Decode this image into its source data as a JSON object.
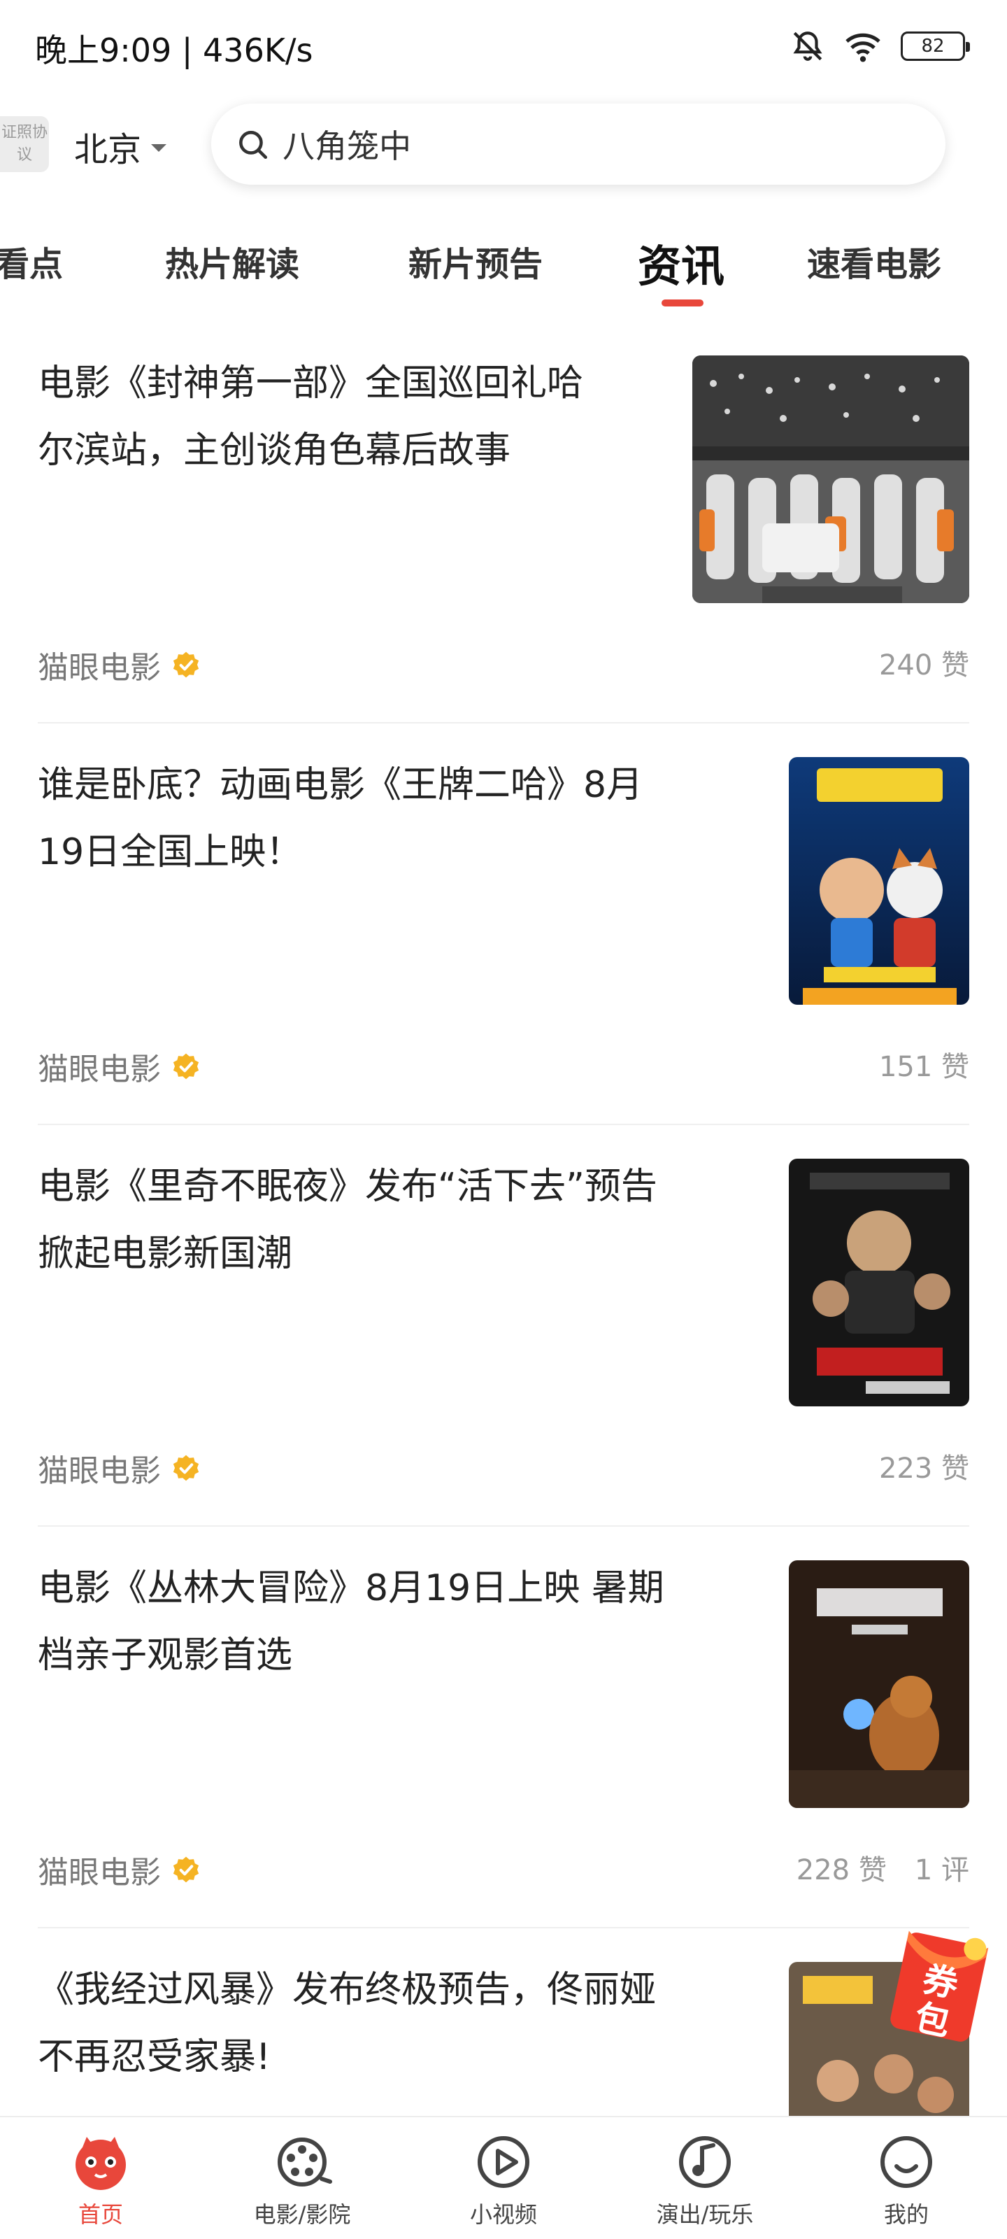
{
  "status_bar": {
    "time_text": "晚上9:09 | 436K/s",
    "battery": "82"
  },
  "header": {
    "license_badge": "证照协议",
    "city": "北京",
    "search_text": "八角笼中"
  },
  "tabs": [
    {
      "label": "看点"
    },
    {
      "label": "热片解读"
    },
    {
      "label": "新片预告"
    },
    {
      "label": "资讯"
    },
    {
      "label": "速看电影"
    }
  ],
  "articles": [
    {
      "title_line1": "电影《封神第一部》全国巡回礼哈",
      "title_line2": "尔滨站，主创谈角色幕后故事",
      "source": "猫眼电影",
      "likes": "240 赞",
      "comments": ""
    },
    {
      "title_line1": "谁是卧底？动画电影《王牌二哈》8月",
      "title_line2": "19日全国上映！",
      "source": "猫眼电影",
      "likes": "151 赞",
      "comments": ""
    },
    {
      "title_line1": "电影《里奇不眠夜》发布“活下去”预告",
      "title_line2": "掀起电影新国潮",
      "source": "猫眼电影",
      "likes": "223 赞",
      "comments": ""
    },
    {
      "title_line1": "电影《丛林大冒险》8月19日上映 暑期",
      "title_line2": "档亲子观影首选",
      "source": "猫眼电影",
      "likes": "228 赞",
      "comments": "1 评"
    },
    {
      "title_line1": "《我经过风暴》发布终极预告，佟丽娅",
      "title_line2": "不再忍受家暴!",
      "source": "",
      "likes": "",
      "comments": ""
    }
  ],
  "coupon_label": "券包",
  "bottom_nav": [
    {
      "label": "首页"
    },
    {
      "label": "电影/影院"
    },
    {
      "label": "小视频"
    },
    {
      "label": "演出/玩乐"
    },
    {
      "label": "我的"
    }
  ],
  "colors": {
    "accent": "#e8473b",
    "verified": "#f5b323",
    "text_primary": "#222222",
    "text_secondary": "#777777"
  }
}
